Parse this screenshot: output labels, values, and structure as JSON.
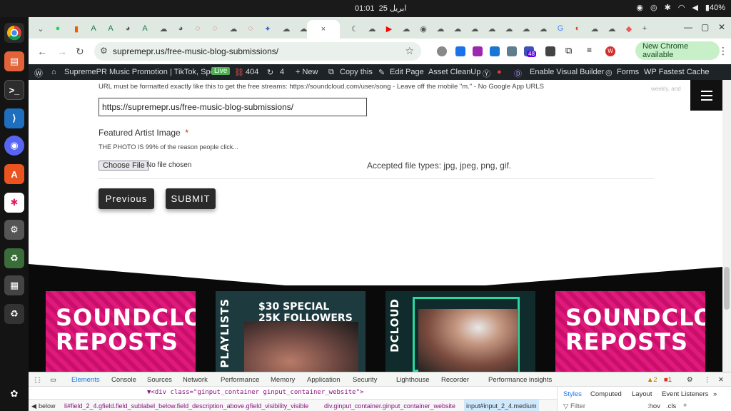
{
  "system": {
    "clock": "01:01",
    "date": "25 ابریل",
    "battery": "40%"
  },
  "browser": {
    "active_tab_close": "×",
    "new_tab": "+",
    "url": "supremepr.us/free-music-blog-submissions/",
    "new_chrome_label": "New Chrome available",
    "extension_badge": "48",
    "profile_initial": "W"
  },
  "wp_admin": {
    "site_title": "SupremePR Music Promotion | TikTok, Spot...",
    "live": "Live",
    "links_count": "404",
    "updates_count": "4",
    "new": "+ New",
    "copy": "Copy this",
    "edit": "Edit Page",
    "cleanup": "Asset CleanUp",
    "builder": "Enable Visual Builder",
    "forms": "Forms",
    "cache": "WP Fastest Cache"
  },
  "form": {
    "url_hint": "URL must be formatted exactly like this to get the free streams: https://soundcloud.com/user/song - Leave off the mobile \"m.\" - No Google App URLS",
    "url_value": "https://supremepr.us/free-music-blog-submissions/",
    "image_label": "Featured Artist Image",
    "required_mark": "*",
    "photo_hint": "THE PHOTO IS 99% of the reason people click...",
    "choose_file": "Choose File",
    "no_file": "No file chosen",
    "accepted": "Accepted file types: jpg, jpeg, png, gif.",
    "previous": "Previous",
    "submit": "SUBMIT",
    "partial_top_text": "weekly, and"
  },
  "footer_cards": [
    {
      "text": "SOUNDCLOUD REPOSTS"
    },
    {
      "vertical": "PLAYLISTS",
      "promo_line1": "$30 SPECIAL",
      "promo_line2": "25K FOLLOWERS"
    },
    {
      "vertical": "DCLOUD"
    },
    {
      "text": "SOUNDCLOUD REPOSTS"
    }
  ],
  "devtools": {
    "tabs": [
      "Elements",
      "Console",
      "Sources",
      "Network",
      "Performance",
      "Memory",
      "Application",
      "Security",
      "Lighthouse",
      "Recorder",
      "Performance insights"
    ],
    "warnings": "2",
    "errors": "1",
    "html_line": "▼<div class=\"ginput_container ginput_container_website\">",
    "crumbs": [
      "below",
      "li#field_2_4.gfield.field_sublabel_below.field_description_above.gfield_visibility_visible",
      "div.ginput_container.ginput_container_website",
      "input#input_2_4.medium"
    ],
    "styles_tabs": [
      "Styles",
      "Computed",
      "Layout",
      "Event Listeners"
    ],
    "filter": "Filter",
    "hov": ":hov",
    "cls": ".cls"
  }
}
